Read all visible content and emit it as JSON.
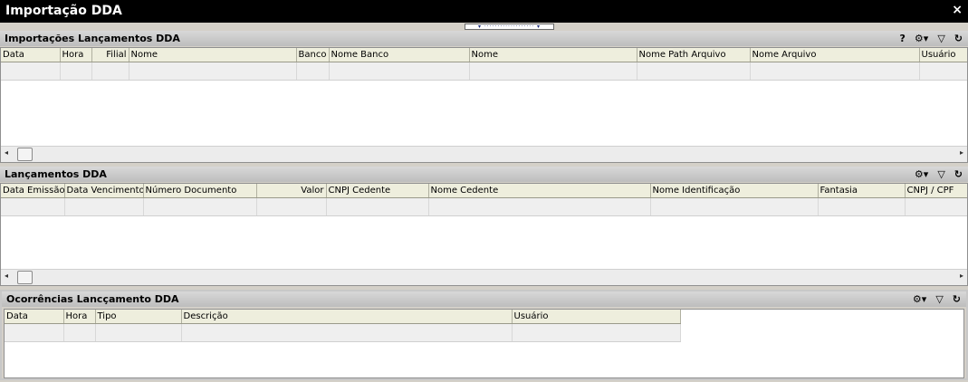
{
  "window": {
    "title": "Importação DDA",
    "close_glyph": "×"
  },
  "splitter": {
    "glyph": "▾ ··················· ▾"
  },
  "panels": [
    {
      "title": "Importações Lançamentos DDA",
      "tools": {
        "help": "?",
        "config": "⚙▾",
        "filter": "▽",
        "refresh": "↻"
      },
      "columns": [
        "Data",
        "Hora",
        "Filial",
        "Nome",
        "Banco",
        "Nome Banco",
        "Nome",
        "Nome Path Arquivo",
        "Nome Arquivo",
        "Usuário"
      ]
    },
    {
      "title": "Lançamentos DDA",
      "tools": {
        "config": "⚙▾",
        "filter": "▽",
        "refresh": "↻"
      },
      "columns": [
        "Data Emissão",
        "Data Vencimento",
        "Número Documento",
        "Valor",
        "CNPJ Cedente",
        "Nome Cedente",
        "Nome Identificação",
        "Fantasia",
        "CNPJ / CPF"
      ]
    },
    {
      "title": "Ocorrências Lancçamento DDA",
      "tools": {
        "config": "⚙▾",
        "filter": "▽",
        "refresh": "↻"
      },
      "columns": [
        "Data",
        "Hora",
        "Tipo",
        "Descrição",
        "Usuário"
      ]
    }
  ],
  "scroll": {
    "left": "◂",
    "right": "▸"
  }
}
